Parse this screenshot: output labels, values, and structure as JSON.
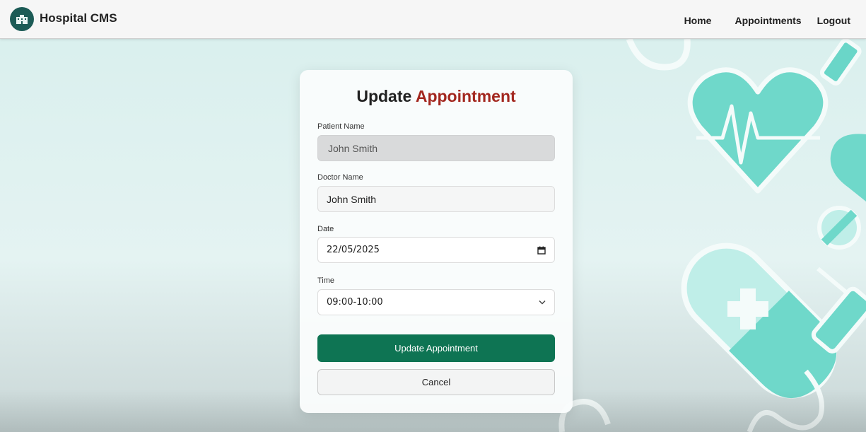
{
  "app": {
    "brand": "Hospital CMS",
    "logo_icon": "hospital-building-icon",
    "accent_color": "#0e7453",
    "title_accent_color": "#a3271f"
  },
  "nav": {
    "home": "Home",
    "appointments": "Appointments",
    "logout": "Logout"
  },
  "form": {
    "title_prefix": "Update",
    "title_accent": "Appointment",
    "patient_label": "Patient Name",
    "patient_value": "John Smith",
    "doctor_label": "Doctor Name",
    "doctor_value": "John Smith",
    "date_label": "Date",
    "date_value": "22/05/2025",
    "date_icon": "calendar-icon",
    "time_label": "Time",
    "time_value": "09:00-10:00",
    "time_icon": "chevron-down-icon",
    "submit_label": "Update Appointment",
    "cancel_label": "Cancel"
  }
}
